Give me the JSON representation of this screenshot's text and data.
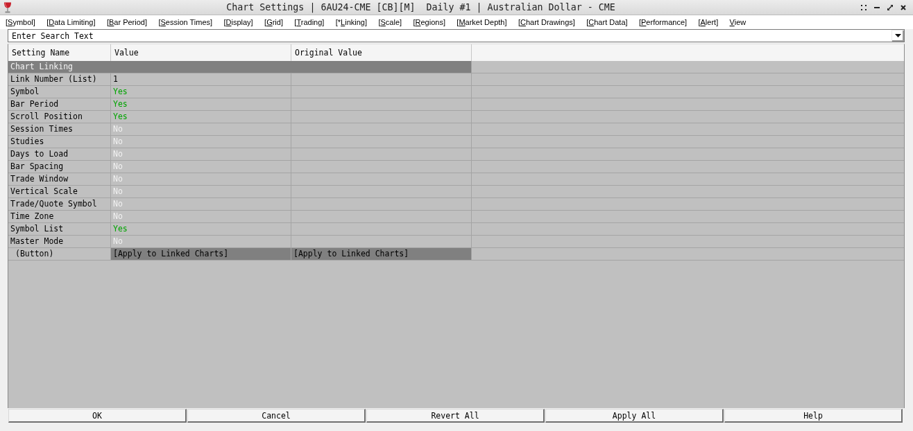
{
  "window": {
    "title": "Chart Settings | 6AU24-CME [CB][M]  Daily #1 | Australian Dollar - CME"
  },
  "menu": [
    "[Symbol]",
    "[Data Limiting]",
    "[Bar Period]",
    "[Session Times]",
    "[Display]",
    "[Grid]",
    "[Trading]",
    "[*Linking]",
    "[Scale]",
    "[Regions]",
    "[Market Depth]",
    "[Chart Drawings]",
    "[Chart Data]",
    "[Performance]",
    "[Alert]",
    "View"
  ],
  "search": {
    "placeholder": "Enter Search Text"
  },
  "table": {
    "columns": [
      "Setting Name",
      "Value",
      "Original Value"
    ],
    "group": "Chart Linking",
    "rows": [
      {
        "kind": "list",
        "name": "Link Number (List)",
        "value": "1"
      },
      {
        "kind": "toggle",
        "name": "Symbol",
        "value": "Yes",
        "on": true
      },
      {
        "kind": "toggle",
        "name": "Bar Period",
        "value": "Yes",
        "on": true
      },
      {
        "kind": "toggle",
        "name": "Scroll Position",
        "value": "Yes",
        "on": true
      },
      {
        "kind": "toggle",
        "name": "Session Times",
        "value": "No",
        "on": false
      },
      {
        "kind": "toggle",
        "name": "Studies",
        "value": "No",
        "on": false
      },
      {
        "kind": "toggle",
        "name": "Days to Load",
        "value": "No",
        "on": false
      },
      {
        "kind": "toggle",
        "name": "Bar Spacing",
        "value": "No",
        "on": false
      },
      {
        "kind": "toggle",
        "name": "Trade Window",
        "value": "No",
        "on": false
      },
      {
        "kind": "toggle",
        "name": "Vertical Scale",
        "value": "No",
        "on": false
      },
      {
        "kind": "toggle",
        "name": "Trade/Quote Symbol",
        "value": "No",
        "on": false
      },
      {
        "kind": "toggle",
        "name": "Time Zone",
        "value": "No",
        "on": false
      },
      {
        "kind": "toggle",
        "name": "Symbol List",
        "value": "Yes",
        "on": true
      },
      {
        "kind": "toggle",
        "name": "Master Mode",
        "value": "No",
        "on": false
      },
      {
        "kind": "button",
        "name": "(Button)",
        "value": "[Apply to Linked Charts]",
        "original_value": "[Apply to Linked Charts]"
      }
    ]
  },
  "buttons": [
    "OK",
    "Cancel",
    "Revert All",
    "Apply All",
    "Help"
  ]
}
